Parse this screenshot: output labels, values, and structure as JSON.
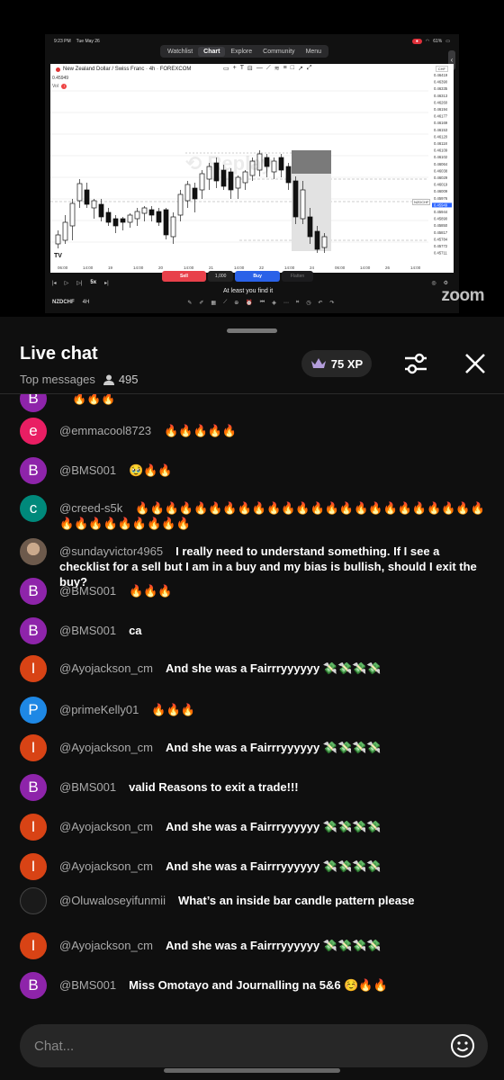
{
  "video": {
    "status_time": "9:23 PM",
    "status_date": "Tue May 26",
    "battery": "61%",
    "tabs": [
      "Watchlist",
      "Chart",
      "Explore",
      "Community",
      "Menu"
    ],
    "active_tab": "Chart",
    "chart_title": "New Zealand Dollar / Swiss Franc · 4h · FOREXCOM",
    "price_readout": "0.45949",
    "vol_label": "Vol",
    "currency": "CHF",
    "watermark": "Replay",
    "symbol_tag": "NZDCHF",
    "y_ticks": [
      "0.46419",
      "0.46390",
      "0.46335",
      "0.46313",
      "0.46260",
      "0.46194",
      "0.46177",
      "0.46169",
      "0.46153",
      "0.46120",
      "0.46118",
      "0.46109",
      "0.46102",
      "0.46064",
      "0.46038",
      "0.46029",
      "0.46019",
      "0.46009",
      "0.45976",
      "0.45949",
      "0.45944",
      "0.45890",
      "0.45850",
      "0.45817",
      "0.45784",
      "0.45772",
      "0.45711"
    ],
    "x_ticks": [
      "06:00",
      "14:00",
      "19",
      "14:00",
      "20",
      "14:00",
      "21",
      "14:00",
      "22",
      "14:00",
      "24",
      "06:00",
      "14:00",
      "26",
      "14:00"
    ],
    "sell_label": "Sell",
    "quantity": "1,000",
    "buy_label": "Buy",
    "flatten_label": "Flatten",
    "replay_speed": "5x",
    "caption": "At least you find it",
    "symbol": "NZDCHF",
    "interval": "4H",
    "zoom_watermark": "zoom",
    "tv_logo": "TV"
  },
  "chat": {
    "title": "Live chat",
    "mode": "Top messages",
    "viewer_count": "495",
    "xp": "75 XP",
    "input_placeholder": "Chat..."
  },
  "messages": [
    {
      "initial": "B",
      "color": "#8e24aa",
      "author": "",
      "text": "🔥🔥🔥",
      "partial": true
    },
    {
      "initial": "e",
      "color": "#e91e63",
      "author": "@emmacool8723",
      "text": "🔥🔥🔥🔥🔥"
    },
    {
      "initial": "B",
      "color": "#8e24aa",
      "author": "@BMS001",
      "text": "🥹🔥🔥"
    },
    {
      "initial": "c",
      "color": "#00897b",
      "author": "@creed-s5k",
      "text": "🔥🔥🔥🔥🔥🔥🔥🔥🔥🔥🔥🔥🔥🔥🔥🔥🔥🔥🔥🔥🔥🔥🔥🔥🔥🔥🔥🔥🔥🔥🔥🔥🔥"
    },
    {
      "initial": "",
      "color": "photo",
      "author": "@sundayvictor4965",
      "text": "I really need to understand something. If I see a checklist for a sell but I am in a buy and my bias is bullish, should I exit the buy?"
    },
    {
      "initial": "B",
      "color": "#8e24aa",
      "author": "@BMS001",
      "text": "🔥🔥🔥"
    },
    {
      "initial": "B",
      "color": "#8e24aa",
      "author": "@BMS001",
      "text": "ca"
    },
    {
      "initial": "I",
      "color": "#d84315",
      "author": "@Ayojackson_cm",
      "text": "And she was a Fairrryyyyyy 💸💸💸💸"
    },
    {
      "initial": "P",
      "color": "#1e88e5",
      "author": "@primeKelly01",
      "text": "🔥🔥🔥"
    },
    {
      "initial": "I",
      "color": "#d84315",
      "author": "@Ayojackson_cm",
      "text": "And she was a Fairrryyyyyy 💸💸💸💸"
    },
    {
      "initial": "B",
      "color": "#8e24aa",
      "author": "@BMS001",
      "text": "valid Reasons to exit a trade!!!"
    },
    {
      "initial": "I",
      "color": "#d84315",
      "author": "@Ayojackson_cm",
      "text": "And she was a Fairrryyyyyy 💸💸💸💸"
    },
    {
      "initial": "I",
      "color": "#d84315",
      "author": "@Ayojackson_cm",
      "text": "And she was a Fairrryyyyyy 💸💸💸💸"
    },
    {
      "initial": "",
      "color": "dark",
      "author": "@Oluwaloseyifunmii",
      "text": "What’s an inside bar candle pattern please"
    },
    {
      "initial": "I",
      "color": "#d84315",
      "author": "@Ayojackson_cm",
      "text": "And she was a Fairrryyyyyy 💸💸💸💸"
    },
    {
      "initial": "B",
      "color": "#8e24aa",
      "author": "@BMS001",
      "text": "Miss Omotayo and Journalling na 5&6 ☺️🔥🔥"
    }
  ]
}
